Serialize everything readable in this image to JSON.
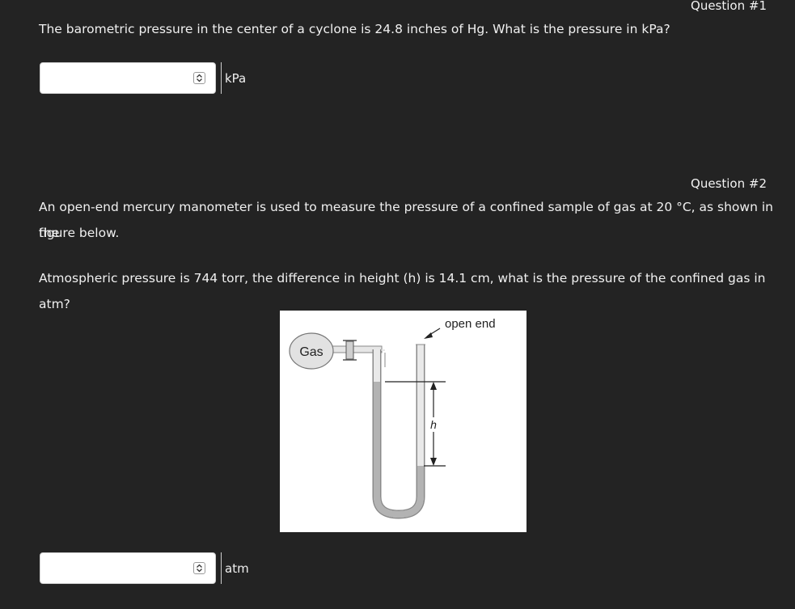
{
  "question1": {
    "label": "Question #1",
    "text": "The barometric pressure in the center of a cyclone is 24.8 inches of Hg. What is the pressure in kPa?",
    "answer_value": "",
    "unit": "kPa"
  },
  "question2": {
    "label": "Question #2",
    "text_line1": "An open-end mercury manometer is used to measure the pressure of a confined sample of gas at 20 °C, as shown in the",
    "text_line2": "figure below.",
    "text_line3": "Atmospheric pressure is 744 torr, the difference in height (h) is 14.1 cm, what is the pressure of the confined gas in atm?",
    "figure": {
      "gas_label": "Gas",
      "open_end_label": "open end",
      "h_label": "h"
    },
    "answer_value": "",
    "unit": "atm"
  },
  "colors": {
    "background": "#232323",
    "text": "#f0f0f0",
    "answer_box": "#ffffff"
  },
  "icons": {
    "spinner": "up-down-spinner-icon"
  }
}
